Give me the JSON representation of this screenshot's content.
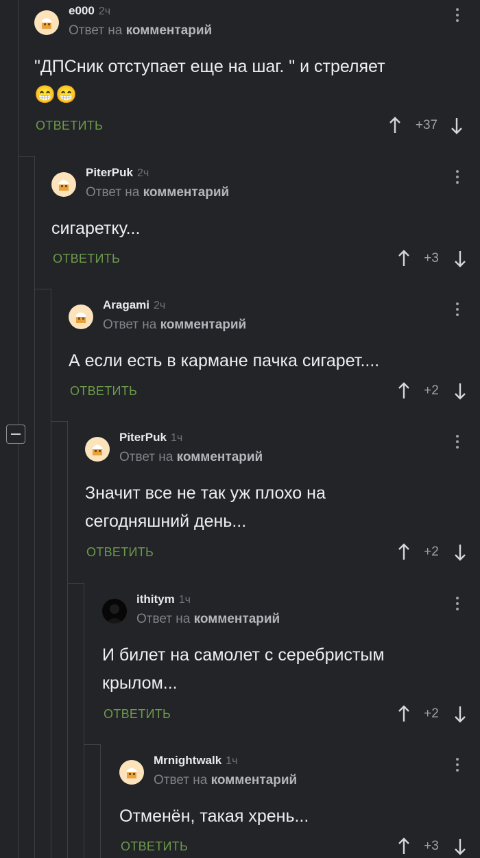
{
  "comments": [
    {
      "author": "e000",
      "time": "2ч",
      "reply_prefix": "Ответ на",
      "reply_link": "комментарий",
      "text": "\"ДПСник отступает еще на шаг. \" и стреляет",
      "emoji": "😁😁",
      "answer": "ОТВЕТИТЬ",
      "score": "+37"
    },
    {
      "author": "PiterPuk",
      "time": "2ч",
      "reply_prefix": "Ответ на",
      "reply_link": "комментарий",
      "text": "сигаретку...",
      "answer": "ОТВЕТИТЬ",
      "score": "+3"
    },
    {
      "author": "Aragami",
      "time": "2ч",
      "reply_prefix": "Ответ на",
      "reply_link": "комментарий",
      "text": "А если есть в кармане пачка сигарет....",
      "answer": "ОТВЕТИТЬ",
      "score": "+2"
    },
    {
      "author": "PiterPuk",
      "time": "1ч",
      "reply_prefix": "Ответ на",
      "reply_link": "комментарий",
      "text": "Значит все не так уж плохо на сегодняшний день...",
      "answer": "ОТВЕТИТЬ",
      "score": "+2"
    },
    {
      "author": "ithitym",
      "time": "1ч",
      "reply_prefix": "Ответ на",
      "reply_link": "комментарий",
      "text": "И билет на самолет с серебристым крылом...",
      "answer": "ОТВЕТИТЬ",
      "score": "+2"
    },
    {
      "author": "Mrnightwalk",
      "time": "1ч",
      "reply_prefix": "Ответ на",
      "reply_link": "комментарий",
      "text": "Отменён, такая хрень...",
      "answer": "ОТВЕТИТЬ",
      "score": "+3"
    }
  ],
  "colors": {
    "background": "#222427",
    "answer": "#6d9a4c",
    "thread_line": "#3c3f44"
  },
  "icons": {
    "menu": "kebab-menu-icon",
    "up": "arrow-up-icon",
    "down": "arrow-down-icon",
    "collapse": "collapse-minus-icon",
    "avatar_default": "chef-avatar-icon"
  }
}
